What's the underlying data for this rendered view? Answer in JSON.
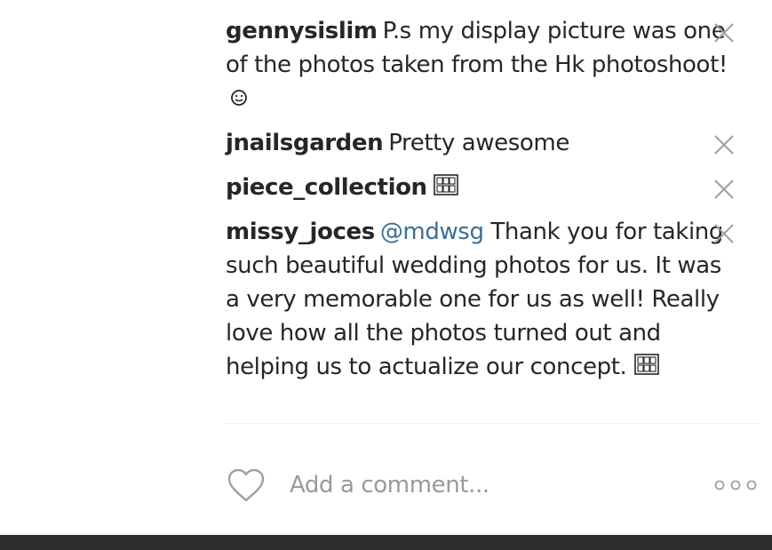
{
  "comments": [
    {
      "username": "gennysislim",
      "text": "P.s my display picture was one of the photos taken from the Hk photoshoot! ",
      "trailing_icon": "smiley-icon"
    },
    {
      "username": "jnailsgarden",
      "text": "Pretty awesome"
    },
    {
      "username": "piece_collection",
      "text": "",
      "trailing_icon": "missing-emoji-glyph-icon"
    },
    {
      "username": "missy_joces",
      "mention": "@mdwsg",
      "text": " Thank you for taking such beautiful wedding photos for us. It was a very memorable one for us as well! Really love how all the photos turned out and helping us to actualize our concept. ",
      "trailing_icon": "missing-emoji-glyph-icon"
    }
  ],
  "composer": {
    "placeholder": "Add a comment..."
  },
  "colors": {
    "mention": "#3c6f93",
    "text": "#262626",
    "icon_gray": "#a0a0a0"
  }
}
